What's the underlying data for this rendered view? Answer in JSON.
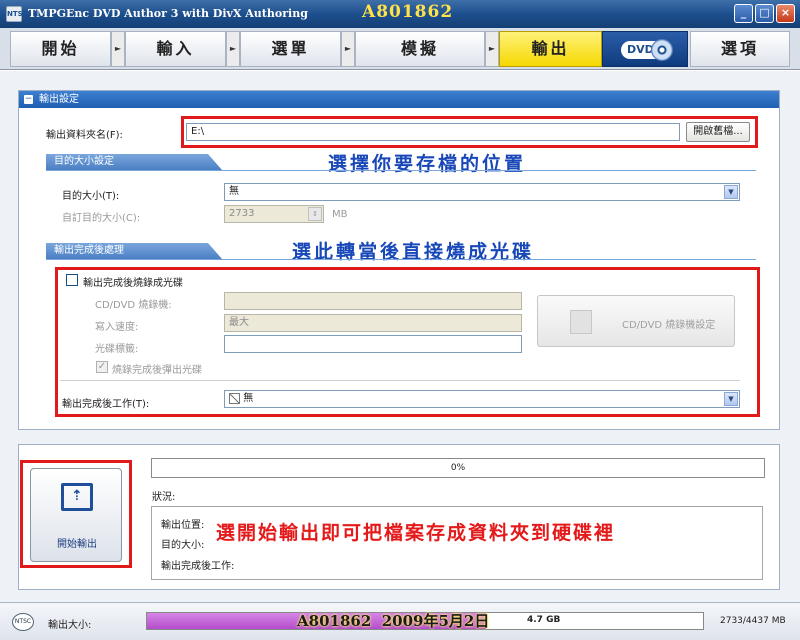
{
  "window": {
    "icon_text": "NTSC",
    "title": "TMPGEnc DVD Author 3 with DivX Authoring",
    "watermark": "A801862",
    "minimize": "_",
    "maximize": "□",
    "close": "×"
  },
  "nav": {
    "tabs": [
      {
        "label": "開始"
      },
      {
        "label": "輸入"
      },
      {
        "label": "選單"
      },
      {
        "label": "模擬"
      },
      {
        "label": "輸出",
        "active": true
      },
      {
        "label": "DVD"
      },
      {
        "label": "選項"
      }
    ],
    "arrow_glyph": "►"
  },
  "output_settings": {
    "header": "輸出設定",
    "folder_label": "輸出資料夾名(F):",
    "folder_value": "E:\\",
    "browse_label": "開啟舊檔...",
    "annotation_folder": "選擇你要存檔的位置",
    "target_size": {
      "section_title": "目的大小設定",
      "size_label": "目的大小(T):",
      "size_value": "無",
      "custom_label": "自訂目的大小(C):",
      "custom_value": "2733",
      "custom_unit": "MB"
    },
    "post_process": {
      "section_title": "輸出完成後處理",
      "annotation": "選此轉當後直接燒成光碟",
      "burn_checkbox_label": "輸出完成後燒錄成光碟",
      "burner_label": "CD/DVD 燒錄機:",
      "burner_value": "",
      "speed_label": "寫入速度:",
      "speed_value": "最大",
      "disc_label_label": "光碟標籤:",
      "disc_label_value": "",
      "eject_label": "燒錄完成後彈出光碟",
      "burner_settings_button": "CD/DVD 燒錄機設定",
      "after_task_label": "輸出完成後工作(T):",
      "after_task_value": "無"
    }
  },
  "bottom": {
    "start_button_label": "開始輸出",
    "progress_text": "0%",
    "progress_value": 0,
    "status_label": "狀況:",
    "info": {
      "location_label": "輸出位置:",
      "size_label": "目的大小:",
      "after_label": "輸出完成後工作:"
    },
    "annotation": "選開始輸出即可把檔案存成資料夾到硬碟裡"
  },
  "statusbar": {
    "ntsc": "NTSC",
    "size_label": "輸出大小:",
    "fill_fraction": 0.61,
    "watermark": "A801862  2009年5月2日",
    "capacity_label": "4.7 GB",
    "size_readout": "2733/4437 MB"
  },
  "colors": {
    "accent": "#1f5fb3",
    "active_tab": "#f5d800",
    "annotation_blue": "#1848b8",
    "annotation_red": "#e41a1a",
    "highlight_box": "#e01a1a",
    "size_fill": "#b44ccc"
  }
}
